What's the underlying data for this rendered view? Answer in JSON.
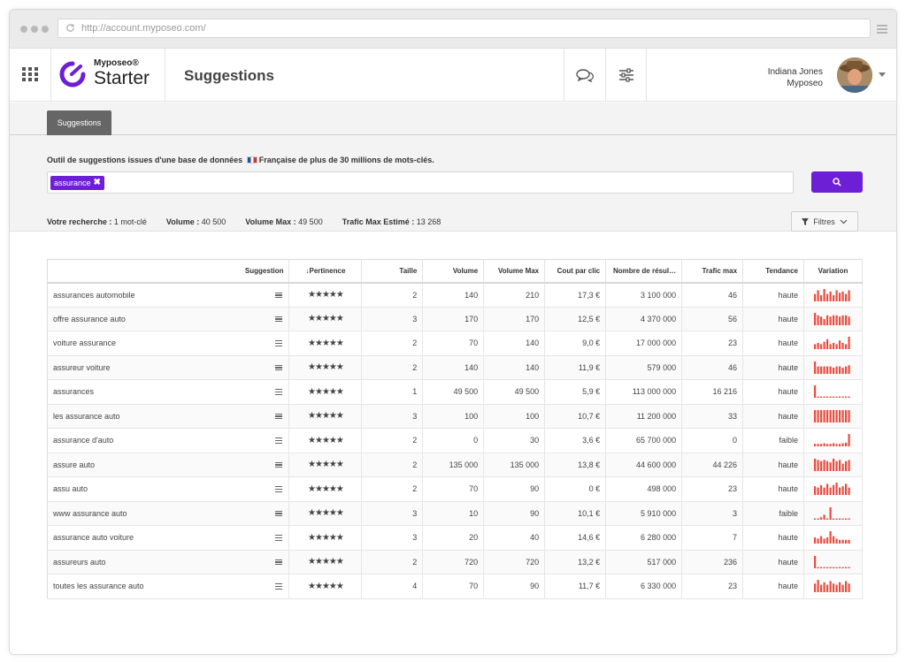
{
  "browser": {
    "url": "http://account.myposeo.com/"
  },
  "header": {
    "brand_small": "Myposeo®",
    "brand_big": "Starter",
    "page_title": "Suggestions",
    "user_name": "Indiana Jones",
    "user_company": "Myposeo"
  },
  "tabs": [
    {
      "label": "Suggestions",
      "active": true
    }
  ],
  "description": {
    "before_flag": "Outil de suggestions issues d'une base de données",
    "after_flag": "Française de plus de 30 millions de mots-clés."
  },
  "search": {
    "tag": "assurance",
    "tag_remove_glyph": "✖"
  },
  "summary": {
    "recherche_label": "Votre recherche :",
    "recherche_value": "1 mot-clé",
    "volume_label": "Volume :",
    "volume_value": "40 500",
    "volume_max_label": "Volume Max :",
    "volume_max_value": "49 500",
    "trafic_label": "Trafic Max Estimé :",
    "trafic_value": "13 268"
  },
  "filter_button": {
    "label": "Filtres"
  },
  "colors": {
    "accent": "#6d1fd6",
    "sparkline": "#ee4b3e"
  },
  "table": {
    "columns": [
      "Suggestion",
      "↓Pertinence",
      "Taille",
      "Volume",
      "Volume Max",
      "Cout par clic",
      "Nombre de résul…",
      "Trafic max",
      "Tendance",
      "Variation"
    ],
    "stars": "★★★★★",
    "rows": [
      {
        "keyword": "assurances automobile",
        "taille": "2",
        "volume": "140",
        "volume_max": "210",
        "cpc": "17,3 €",
        "results": "3 100 000",
        "trafic": "46",
        "tendance": "haute",
        "variation": [
          0.6,
          0.9,
          0.5,
          1,
          0.6,
          0.8,
          0.5,
          0.9,
          0.7,
          0.8,
          0.6,
          0.9
        ]
      },
      {
        "keyword": "offre assurance auto",
        "taille": "3",
        "volume": "170",
        "volume_max": "170",
        "cpc": "12,5 €",
        "results": "4 370 000",
        "trafic": "56",
        "tendance": "haute",
        "variation": [
          1,
          0.8,
          0.7,
          0.5,
          0.8,
          0.7,
          0.8,
          0.8,
          0.7,
          0.8,
          0.8,
          0.7
        ]
      },
      {
        "keyword": "voiture assurance",
        "taille": "2",
        "volume": "70",
        "volume_max": "140",
        "cpc": "9,0 €",
        "results": "17 000 000",
        "trafic": "23",
        "tendance": "haute",
        "variation": [
          0.4,
          0.5,
          0.4,
          0.6,
          0.8,
          0.4,
          0.5,
          0.4,
          0.7,
          0.5,
          0.4,
          1
        ]
      },
      {
        "keyword": "assureur voiture",
        "taille": "2",
        "volume": "140",
        "volume_max": "140",
        "cpc": "11,9 €",
        "results": "579 000",
        "trafic": "46",
        "tendance": "haute",
        "variation": [
          1,
          0.6,
          0.6,
          0.6,
          0.6,
          0.6,
          0.5,
          0.6,
          0.6,
          0.5,
          0.6,
          0.7
        ]
      },
      {
        "keyword": "assurances",
        "taille": "1",
        "volume": "49 500",
        "volume_max": "49 500",
        "cpc": "5,9 €",
        "results": "113 000 000",
        "trafic": "16 216",
        "tendance": "haute",
        "variation": [
          1,
          0.1,
          0.1,
          0.1,
          0.1,
          0.1,
          0.1,
          0.1,
          0.1,
          0.1,
          0.1,
          0.1
        ]
      },
      {
        "keyword": "les assurance auto",
        "taille": "3",
        "volume": "100",
        "volume_max": "100",
        "cpc": "10,7 €",
        "results": "11 200 000",
        "trafic": "33",
        "tendance": "haute",
        "variation": [
          1,
          1,
          1,
          1,
          1,
          1,
          1,
          1,
          1,
          1,
          1,
          1
        ]
      },
      {
        "keyword": "assurance d'auto",
        "taille": "2",
        "volume": "0",
        "volume_max": "30",
        "cpc": "3,6 €",
        "results": "65 700 000",
        "trafic": "0",
        "tendance": "faible",
        "variation": [
          0.2,
          0.2,
          0.2,
          0.25,
          0.2,
          0.2,
          0.25,
          0.2,
          0.2,
          0.25,
          0.3,
          1
        ]
      },
      {
        "keyword": "assure auto",
        "taille": "2",
        "volume": "135 000",
        "volume_max": "135 000",
        "cpc": "13,8 €",
        "results": "44 600 000",
        "trafic": "44 226",
        "tendance": "haute",
        "variation": [
          1,
          0.9,
          0.8,
          0.9,
          0.8,
          0.7,
          1,
          0.8,
          0.9,
          0.6,
          0.8,
          0.9
        ]
      },
      {
        "keyword": "assu auto",
        "taille": "2",
        "volume": "70",
        "volume_max": "90",
        "cpc": "0 €",
        "results": "498 000",
        "trafic": "23",
        "tendance": "haute",
        "variation": [
          0.7,
          0.6,
          0.8,
          0.6,
          0.9,
          0.6,
          0.8,
          1,
          0.6,
          0.7,
          0.9,
          0.6
        ]
      },
      {
        "keyword": "www assurance auto",
        "taille": "3",
        "volume": "10",
        "volume_max": "90",
        "cpc": "10,1 €",
        "results": "5 910 000",
        "trafic": "3",
        "tendance": "faible",
        "variation": [
          0.1,
          0.1,
          0.2,
          0.4,
          0.1,
          1,
          0.1,
          0.1,
          0.1,
          0.1,
          0.1,
          0.1
        ]
      },
      {
        "keyword": "assurance auto voiture",
        "taille": "3",
        "volume": "20",
        "volume_max": "40",
        "cpc": "14,6 €",
        "results": "6 280 000",
        "trafic": "7",
        "tendance": "haute",
        "variation": [
          0.5,
          0.4,
          0.6,
          0.4,
          0.5,
          1,
          0.6,
          0.4,
          0.3,
          0.3,
          0.3,
          0.3
        ]
      },
      {
        "keyword": "assureurs auto",
        "taille": "2",
        "volume": "720",
        "volume_max": "720",
        "cpc": "13,2 €",
        "results": "517 000",
        "trafic": "236",
        "tendance": "haute",
        "variation": [
          1,
          0.1,
          0.1,
          0.1,
          0.1,
          0.1,
          0.1,
          0.1,
          0.1,
          0.1,
          0.1,
          0.1
        ]
      },
      {
        "keyword": "toutes les assurance auto",
        "taille": "4",
        "volume": "70",
        "volume_max": "90",
        "cpc": "11,7 €",
        "results": "6 330 000",
        "trafic": "23",
        "tendance": "haute",
        "variation": [
          0.7,
          1,
          0.6,
          0.8,
          0.6,
          0.9,
          0.7,
          0.6,
          0.8,
          0.6,
          0.9,
          0.7
        ]
      }
    ]
  }
}
